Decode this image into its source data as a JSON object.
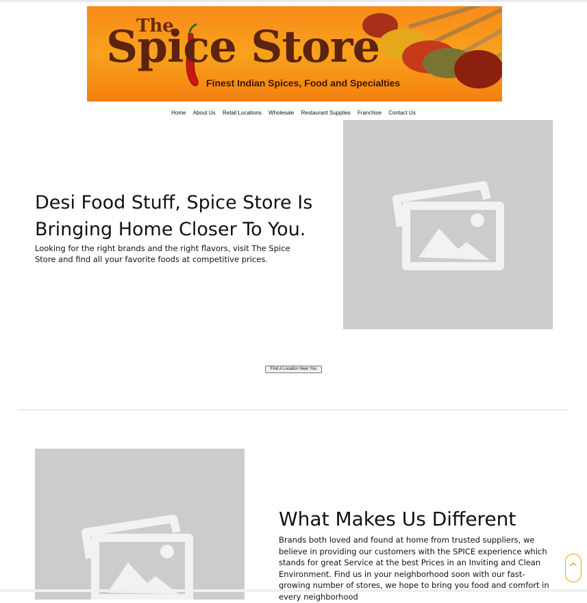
{
  "banner": {
    "logo_the": "The",
    "logo_main": "Spice Store",
    "tagline": "Finest Indian Spices, Food and Specialties"
  },
  "nav": {
    "items": [
      "Home",
      "About Us",
      "Retail Locations",
      "Wholesale",
      "Restaurant Supplies",
      "Franchise",
      "Contact Us"
    ]
  },
  "hero": {
    "title": "Desi Food Stuff, Spice Store Is Bringing Home Closer To You.",
    "body": "Looking for the right brands and the right flavors, visit The Spice Store and find all your favorite foods at competitive prices.",
    "image_icon": "image-placeholder-icon",
    "cta_label": "Find A Location Near You"
  },
  "different": {
    "title": "What Makes Us Different",
    "body": "Brands both loved and found at home from trusted suppliers, we believe in providing our customers with the SPICE experience which stands for great Service at the best Prices in an Inviting and Clean Environment. Find us in your neighborhood soon with our fast-growing number of stores, we hope to bring you food and comfort in every neighborhood",
    "image_icon": "image-placeholder-icon"
  },
  "scroll_top": {
    "label": "^",
    "icon": "chevron-up-icon"
  },
  "colors": {
    "banner_orange": "#f7931e",
    "logo_brown": "#5b2310",
    "placeholder_gray": "#cccccc",
    "scroll_accent": "#f0a500"
  }
}
